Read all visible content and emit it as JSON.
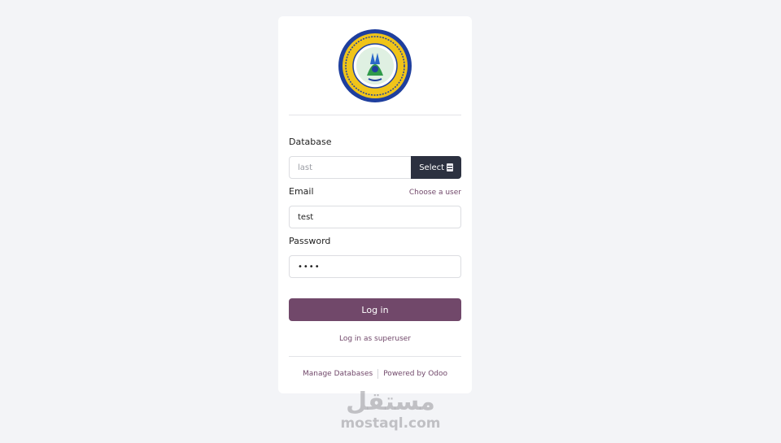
{
  "form": {
    "database_label": "Database",
    "database_placeholder": "last",
    "select_label": "Select",
    "email_label": "Email",
    "choose_user_link": "Choose a user",
    "email_value": "test",
    "password_label": "Password",
    "password_value": "••••",
    "login_button": "Log in",
    "superuser_link": "Log in as superuser"
  },
  "footer": {
    "manage_databases": "Manage Databases",
    "powered_by": "Powered by Odoo"
  },
  "watermark": {
    "arabic": "مستقل",
    "latin": "mostaql.com"
  },
  "icons": {
    "logo": "school-seal-logo",
    "select": "database-icon"
  },
  "colors": {
    "primary": "#71486a",
    "select_button": "#2c3140",
    "background": "#f3f4f7"
  }
}
